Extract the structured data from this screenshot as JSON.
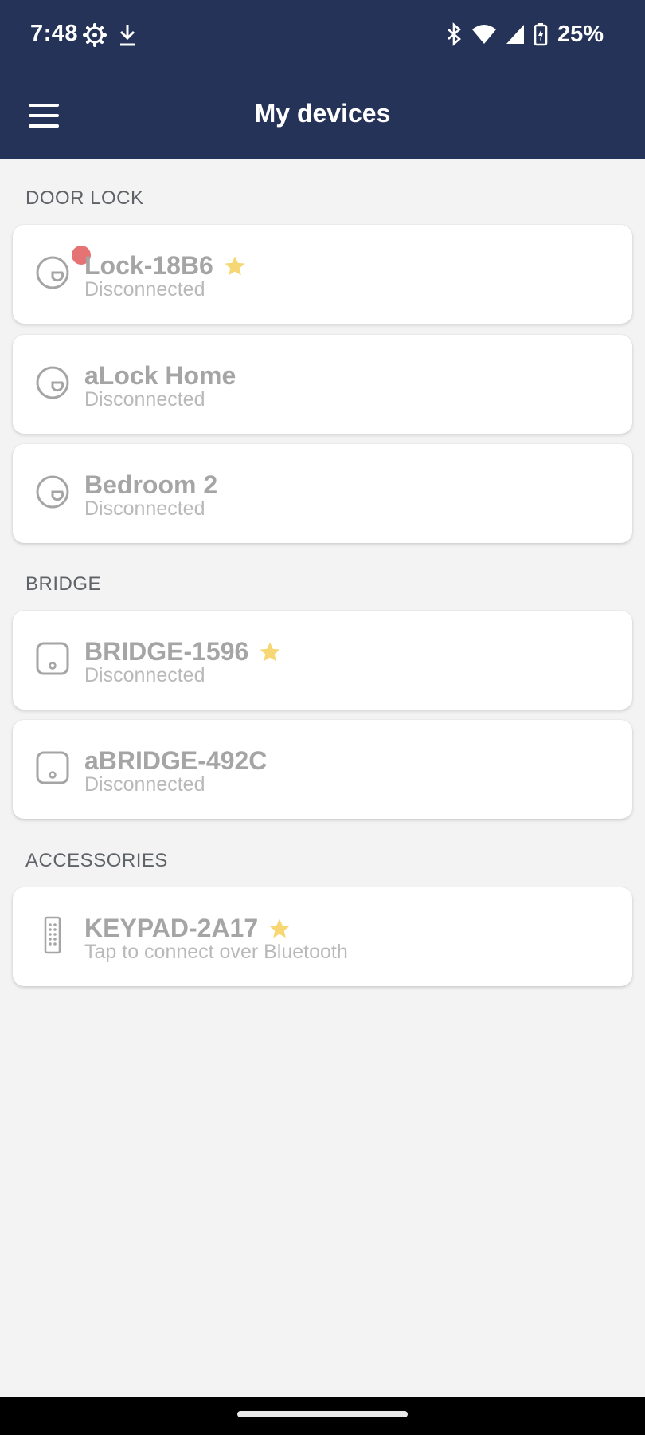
{
  "status_bar": {
    "time": "7:48",
    "battery": "25%",
    "left_icons": [
      "settings-gear-icon",
      "download-icon"
    ],
    "right_icons": [
      "bluetooth-icon",
      "wifi-icon",
      "cell-signal-icon",
      "battery-charging-icon"
    ]
  },
  "header": {
    "title": "My devices",
    "menu_icon": "hamburger-menu-icon",
    "background_color": "#263358"
  },
  "sections": [
    {
      "label": "DOOR LOCK",
      "devices": [
        {
          "name": "Lock-18B6",
          "status": "Disconnected",
          "favorite": true,
          "alert": true,
          "icon": "lock-icon"
        },
        {
          "name": "aLock Home",
          "status": "Disconnected",
          "favorite": false,
          "alert": false,
          "icon": "lock-icon"
        },
        {
          "name": "Bedroom 2",
          "status": "Disconnected",
          "favorite": false,
          "alert": false,
          "icon": "lock-icon"
        }
      ]
    },
    {
      "label": "BRIDGE",
      "devices": [
        {
          "name": "BRIDGE-1596",
          "status": "Disconnected",
          "favorite": true,
          "alert": false,
          "icon": "bridge-icon"
        },
        {
          "name": "aBRIDGE-492C",
          "status": "Disconnected",
          "favorite": false,
          "alert": false,
          "icon": "bridge-icon"
        }
      ]
    },
    {
      "label": "ACCESSORIES",
      "devices": [
        {
          "name": "KEYPAD-2A17",
          "status": "Tap to connect over Bluetooth",
          "favorite": true,
          "alert": false,
          "icon": "keypad-icon"
        }
      ]
    }
  ],
  "colors": {
    "favorite_star": "#f7d774",
    "alert_dot": "#e57373",
    "device_text": "#a5a5a5"
  }
}
